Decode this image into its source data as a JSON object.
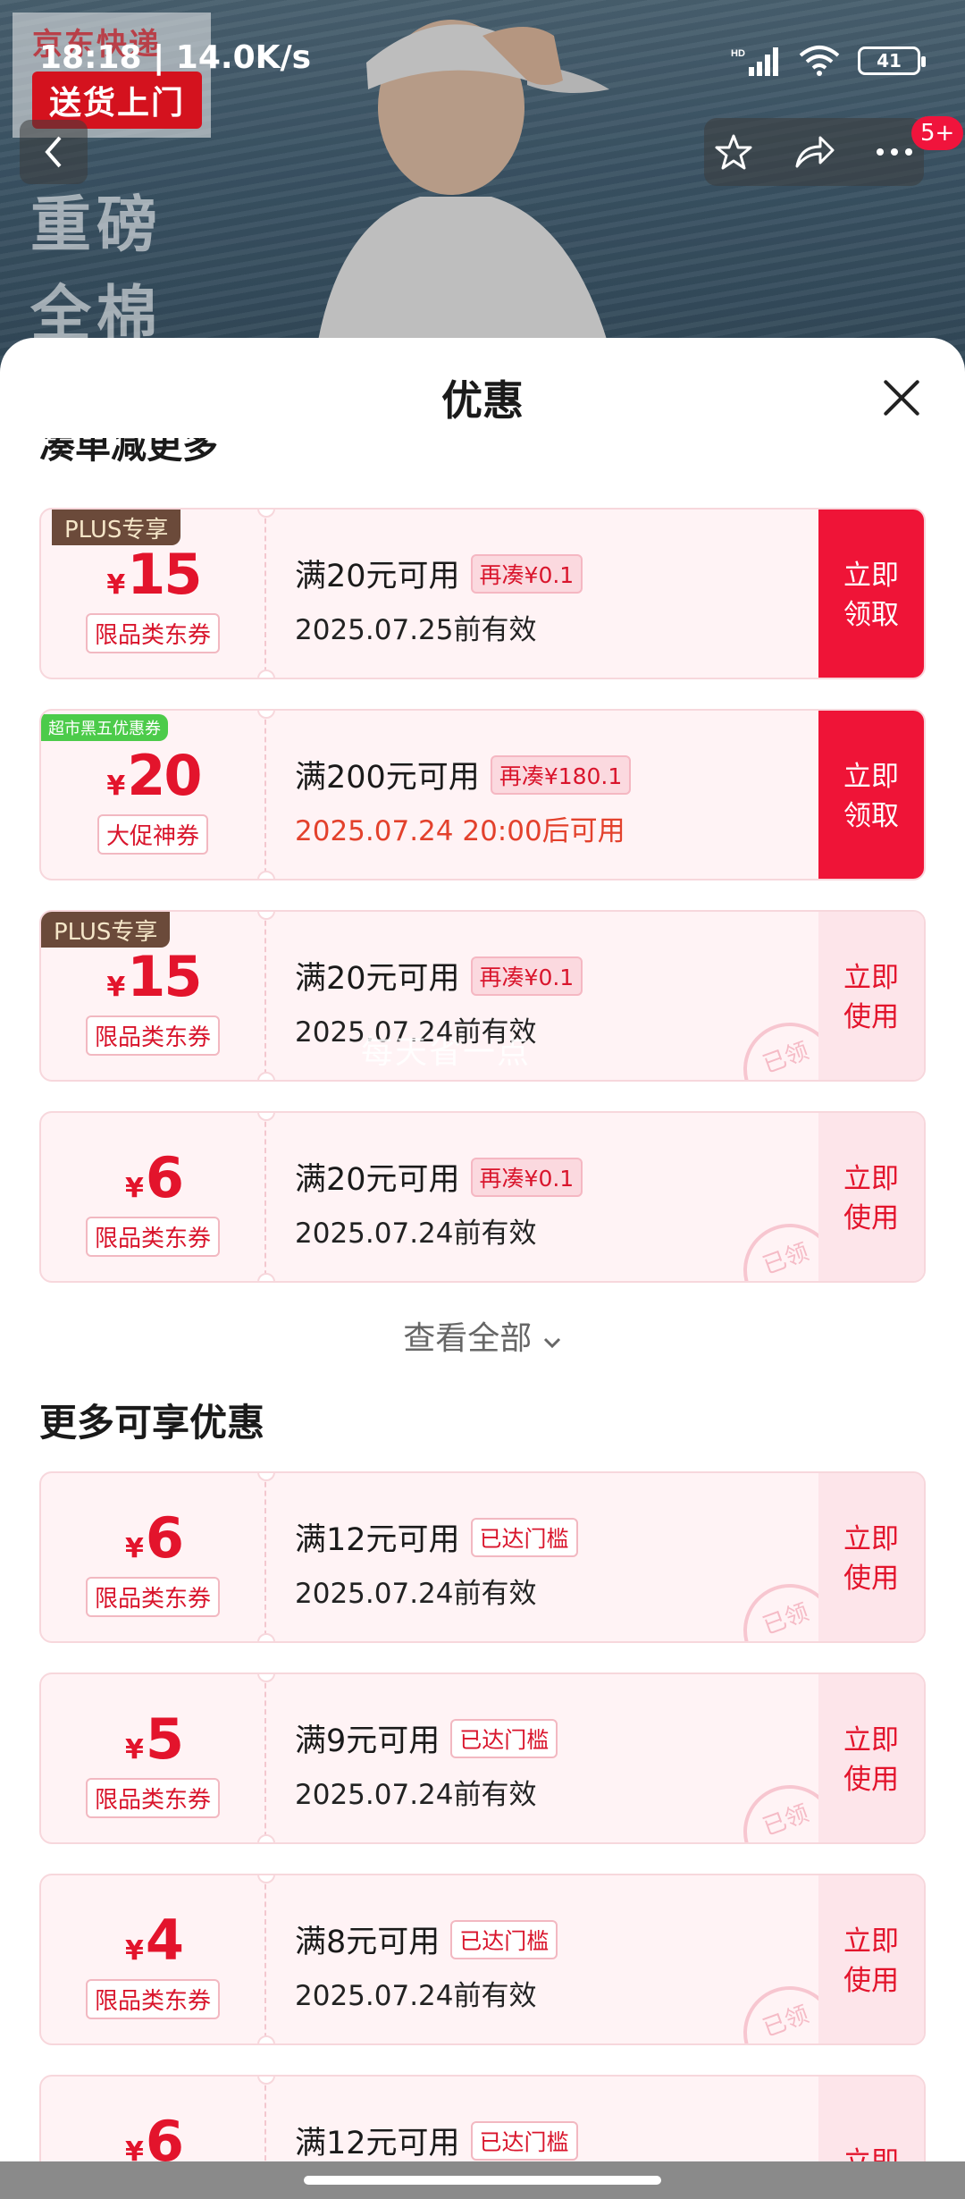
{
  "status": {
    "time": "18:18 | 14.0K/s",
    "battery": "41"
  },
  "background": {
    "badge_line1": "京东快递",
    "badge_line2": "送货上门",
    "promo_line1": "重磅",
    "promo_line2": "全棉",
    "notify_badge": "5+"
  },
  "sheet": {
    "title": "优惠",
    "partial_heading": "凑单减更多",
    "watermark": "每天省一点",
    "see_all": "查看全部",
    "section_more": "更多可享优惠",
    "stamp_text": "已领"
  },
  "coupons_top": [
    {
      "currency": "¥",
      "amount": "15",
      "tag": "PLUS专享",
      "type": "限品类东券",
      "condition": "满20元可用",
      "pill": "再凑¥0.1",
      "validity": "2025.07.25前有效",
      "action_line1": "立即",
      "action_line2": "领取"
    },
    {
      "currency": "¥",
      "amount": "20",
      "tag": "超市黑五优惠券",
      "type": "大促神券",
      "condition": "满200元可用",
      "pill": "再凑¥180.1",
      "validity": "2025.07.24 20:00后可用",
      "action_line1": "立即",
      "action_line2": "领取"
    },
    {
      "currency": "¥",
      "amount": "15",
      "tag": "PLUS专享",
      "type": "限品类东券",
      "condition": "满20元可用",
      "pill": "再凑¥0.1",
      "validity": "2025.07.24前有效",
      "action_line1": "立即",
      "action_line2": "使用"
    },
    {
      "currency": "¥",
      "amount": "6",
      "type": "限品类东券",
      "condition": "满20元可用",
      "pill": "再凑¥0.1",
      "validity": "2025.07.24前有效",
      "action_line1": "立即",
      "action_line2": "使用"
    }
  ],
  "coupons_more": [
    {
      "currency": "¥",
      "amount": "6",
      "type": "限品类东券",
      "condition": "满12元可用",
      "pill": "已达门槛",
      "validity": "2025.07.24前有效",
      "action_line1": "立即",
      "action_line2": "使用"
    },
    {
      "currency": "¥",
      "amount": "5",
      "type": "限品类东券",
      "condition": "满9元可用",
      "pill": "已达门槛",
      "validity": "2025.07.24前有效",
      "action_line1": "立即",
      "action_line2": "使用"
    },
    {
      "currency": "¥",
      "amount": "4",
      "type": "限品类东券",
      "condition": "满8元可用",
      "pill": "已达门槛",
      "validity": "2025.07.24前有效",
      "action_line1": "立即",
      "action_line2": "使用"
    },
    {
      "currency": "¥",
      "amount": "6",
      "condition": "满12元可用",
      "pill": "已达门槛",
      "action_line1": "立即"
    }
  ],
  "colors": {
    "accent": "#ef1437",
    "price": "#e3142c",
    "card_bg": "#fff3f5",
    "use_bg": "#fde5ea",
    "plus_tag": "#6b4a3a",
    "green_tag": "#4ccb4a"
  },
  "icons": [
    "back-arrow-icon",
    "star-icon",
    "share-icon",
    "more-icon",
    "close-icon",
    "chevron-down-icon",
    "wifi-icon",
    "signal-icon",
    "battery-icon"
  ]
}
